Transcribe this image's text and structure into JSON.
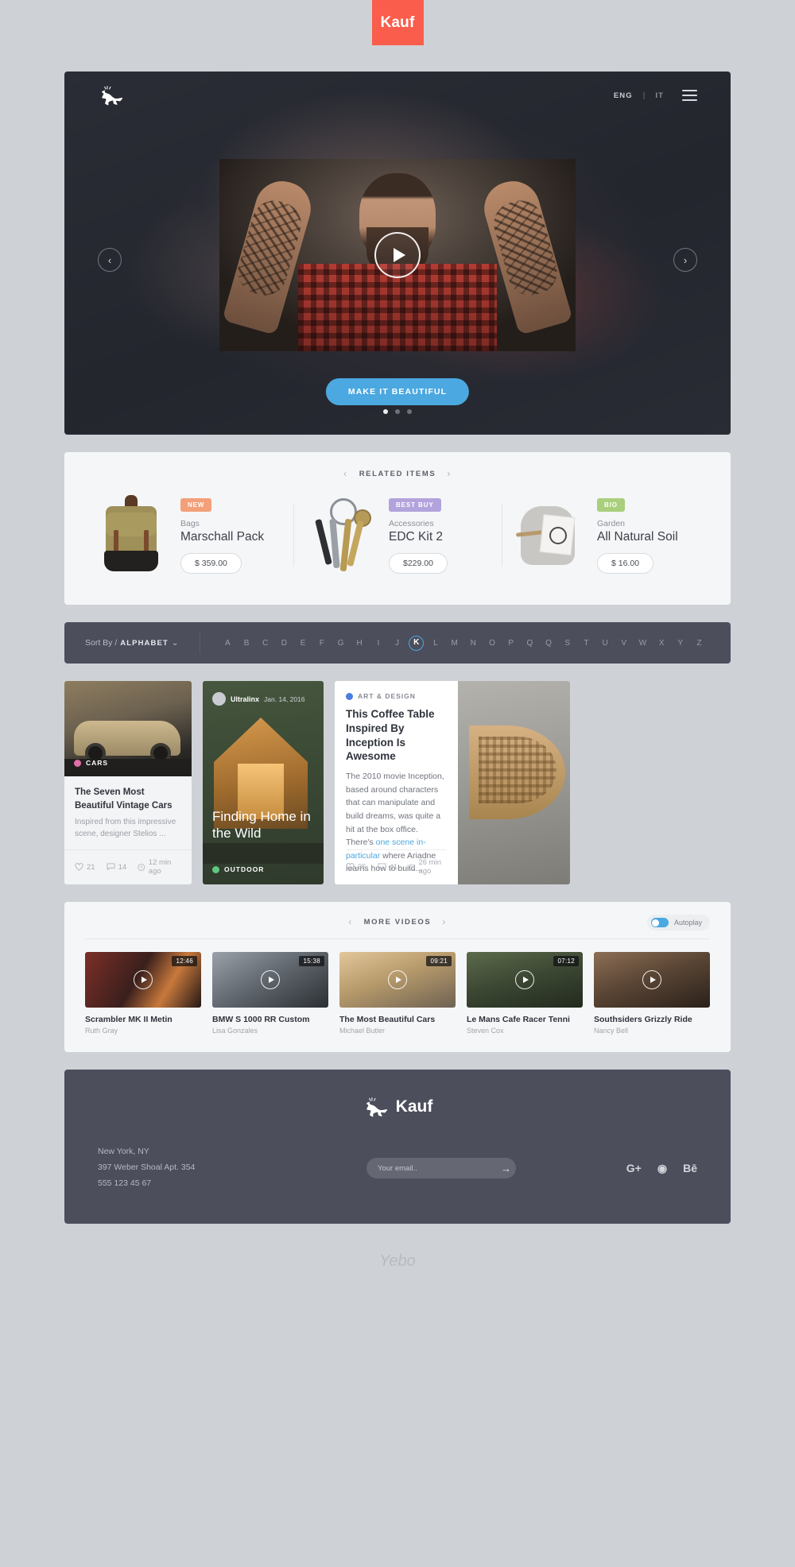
{
  "brand": {
    "badge": "Kauf",
    "logo_icon": "deer-icon"
  },
  "hero": {
    "lang_primary": "ENG",
    "lang_separator": "|",
    "lang_secondary": "IT",
    "menu_icon": "hamburger-icon",
    "prev_icon": "chevron-left-icon",
    "next_icon": "chevron-right-icon",
    "play_icon": "play-icon",
    "cta_label": "MAKE IT BEAUTIFUL",
    "cta_color": "#4ba8e0",
    "slides": 3,
    "active_slide": 1
  },
  "related": {
    "heading": "RELATED ITEMS",
    "prev_icon": "chevron-left-icon",
    "next_icon": "chevron-right-icon",
    "items": [
      {
        "tag": "NEW",
        "tag_color": "#f3a07a",
        "category": "Bags",
        "name": "Marschall Pack",
        "price": "$ 359.00",
        "image": "backpack-image"
      },
      {
        "tag": "BEST BUY",
        "tag_color": "#b2a3dd",
        "category": "Accessories",
        "name": "EDC Kit 2",
        "price": "$229.00",
        "image": "keychain-image"
      },
      {
        "tag": "BIO",
        "tag_color": "#a9cf7d",
        "category": "Garden",
        "name": "All Natural Soil",
        "price": "$ 16.00",
        "image": "soil-bag-image"
      }
    ]
  },
  "sortbar": {
    "label": "Sort By /",
    "value": "ALPHABET",
    "caret_icon": "chevron-down-icon",
    "letters": [
      "A",
      "B",
      "C",
      "D",
      "E",
      "F",
      "G",
      "H",
      "I",
      "J",
      "K",
      "L",
      "M",
      "N",
      "O",
      "P",
      "Q",
      "Q",
      "S",
      "T",
      "U",
      "V",
      "W",
      "X",
      "Y",
      "Z"
    ],
    "selected_letter": "K",
    "selected_color": "#4ba8e0"
  },
  "cards": {
    "card1": {
      "category": "CARS",
      "category_color": "#e26ea8",
      "title": "The Seven Most Beautiful Vintage Cars",
      "desc": "Inspired from this impressive scene, designer Stelios ...",
      "likes": "21",
      "comments": "14",
      "time": "12 min ago",
      "image": "vintage-car-image"
    },
    "card2": {
      "author": "Ultralinx",
      "date": "Jan. 14, 2016",
      "title": "Finding Home in the Wild",
      "category": "OUTDOOR",
      "category_color": "#5ec77f",
      "image": "cabin-house-image"
    },
    "card3": {
      "category": "ART & DESIGN",
      "category_color": "#4a7fe0",
      "title": "This Coffee Table Inspired By Inception Is Awesome",
      "body_before": "The 2010 movie Inception, based around characters that can manipulate and build dreams, was quite a hit at the box office. There's ",
      "link_text": "one scene in-particular",
      "body_after": " where Ariadne learns how to build...",
      "likes": "35",
      "comments": "41",
      "time": "26 min ago",
      "image": "coffee-table-image"
    }
  },
  "videos": {
    "heading": "MORE VIDEOS",
    "prev_icon": "chevron-left-icon",
    "next_icon": "chevron-right-icon",
    "autoplay_label": "Autoplay",
    "autoplay_on": true,
    "items": [
      {
        "title": "Scrambler MK II Metin",
        "author": "Ruth Gray",
        "duration": "12:46",
        "image": "motorcycle-night-image"
      },
      {
        "title": "BMW S 1000 RR Custom",
        "author": "Lisa Gonzales",
        "duration": "15:38",
        "image": "bmw-bike-image"
      },
      {
        "title": "The Most Beautiful Cars",
        "author": "Michael Butler",
        "duration": "09:21",
        "image": "silver-car-image"
      },
      {
        "title": "Le Mans Cafe Racer Tenni",
        "author": "Steven Cox",
        "duration": "07:12",
        "image": "cafe-racer-image"
      },
      {
        "title": "Southsiders Grizzly Ride",
        "author": "Nancy Bell",
        "duration": "",
        "image": "grizzly-ride-image"
      }
    ]
  },
  "footer": {
    "logo_text": "Kauf",
    "logo_icon": "deer-icon",
    "address_line1": "New York, NY",
    "address_line2": "397 Weber Shoal Apt. 354",
    "address_line3": "555 123 45 67",
    "email_placeholder": "Your email..",
    "email_value": "",
    "submit_icon": "arrow-right-icon",
    "socials": [
      {
        "name": "google-plus-icon",
        "glyph": "G+"
      },
      {
        "name": "dribbble-icon",
        "glyph": "◉"
      },
      {
        "name": "behance-icon",
        "glyph": "Bē"
      }
    ]
  },
  "watermark": {
    "text": "Yebo"
  }
}
